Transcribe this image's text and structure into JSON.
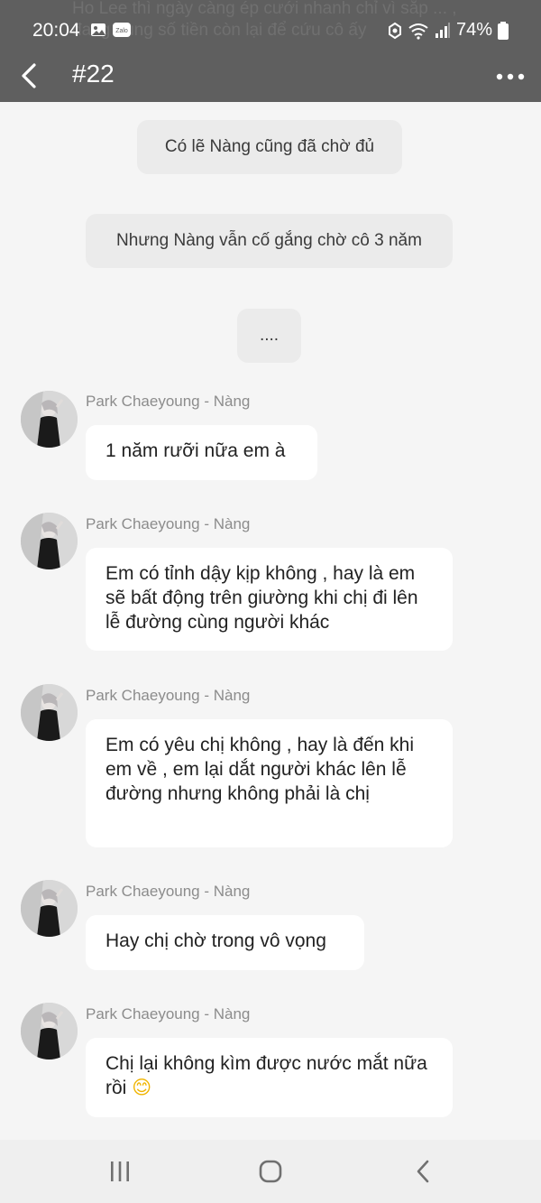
{
  "status_bar": {
    "time": "20:04",
    "battery": "74%",
    "icons": [
      "gallery-icon",
      "zalo-icon",
      "battery-saver-icon",
      "wifi-icon",
      "signal-icon",
      "battery-icon"
    ],
    "zalo_label": "Zalo"
  },
  "notification_ghost": {
    "text": "Ho Lee thì ngày càng ép cưới nhanh chỉ vì sắp ... , đang dùng số tiền còn lại để cứu cô ấy"
  },
  "header": {
    "title": "#22"
  },
  "system_messages": [
    {
      "text": "Có lẽ Nàng cũng đã chờ đủ"
    },
    {
      "text": "Nhưng Nàng vẫn cố gắng chờ cô 3 năm"
    },
    {
      "text": "...."
    }
  ],
  "messages": [
    {
      "sender": "Park Chaeyoung - Nàng",
      "text": "1 năm rưỡi nữa em à"
    },
    {
      "sender": "Park Chaeyoung - Nàng",
      "text": "Em có tỉnh dậy kịp không , hay là em sẽ bất động trên giường khi chị đi lên lễ đường cùng người khác"
    },
    {
      "sender": "Park Chaeyoung - Nàng",
      "text": "Em có yêu chị không , hay là đến khi em về , em lại dắt người khác lên lễ đường nhưng không phải là chị"
    },
    {
      "sender": "Park Chaeyoung - Nàng",
      "text": "Hay chị chờ trong vô vọng"
    },
    {
      "sender": "Park Chaeyoung - Nàng",
      "text": "Chị lại không kìm được nước mắt nữa rồi",
      "emoji": "😊"
    }
  ],
  "nav_bar": {
    "buttons": [
      "recent-apps",
      "home",
      "back"
    ]
  }
}
